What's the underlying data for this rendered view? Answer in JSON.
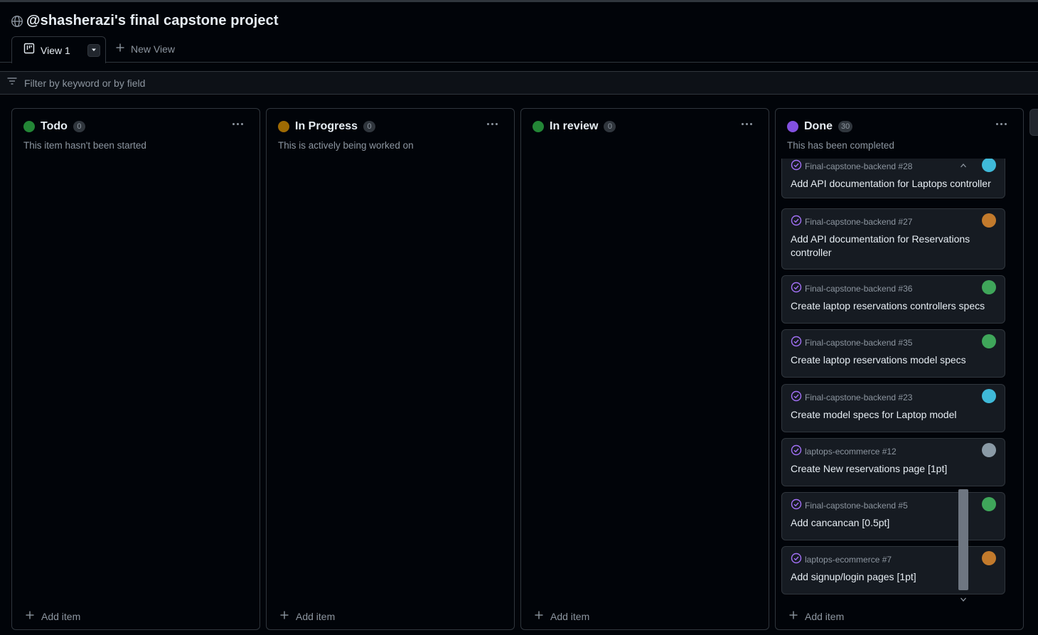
{
  "project": {
    "title": "@shasherazi's final capstone project"
  },
  "views": {
    "active_label": "View 1",
    "new_view_label": "New View"
  },
  "filter": {
    "placeholder": "Filter by keyword or by field"
  },
  "columns": [
    {
      "title": "Todo",
      "count": "0",
      "description": "This item hasn't been started",
      "color": "#238636",
      "add_label": "Add item"
    },
    {
      "title": "In Progress",
      "count": "0",
      "description": "This is actively being worked on",
      "color": "#9e6a03",
      "add_label": "Add item"
    },
    {
      "title": "In review",
      "count": "0",
      "description": "",
      "color": "#238636",
      "add_label": "Add item"
    },
    {
      "title": "Done",
      "count": "30",
      "description": "This has been completed",
      "color": "#8250df",
      "add_label": "Add item"
    }
  ],
  "done_cards": [
    {
      "ref": "Final-capstone-backend #28",
      "title": "Add API documentation for Laptops controller",
      "avatar_color": "#3fb9d8"
    },
    {
      "ref": "Final-capstone-backend #27",
      "title": "Add API documentation for Reservations controller",
      "avatar_color": "#c27a2c"
    },
    {
      "ref": "Final-capstone-backend #36",
      "title": "Create laptop reservations controllers specs",
      "avatar_color": "#3fa65a"
    },
    {
      "ref": "Final-capstone-backend #35",
      "title": "Create laptop reservations model specs",
      "avatar_color": "#3fa65a"
    },
    {
      "ref": "Final-capstone-backend #23",
      "title": "Create model specs for Laptop model",
      "avatar_color": "#3fb9d8"
    },
    {
      "ref": "laptops-ecommerce #12",
      "title": "Create New reservations page [1pt]",
      "avatar_color": "#8a9aa6"
    },
    {
      "ref": "Final-capstone-backend #5",
      "title": "Add cancancan [0.5pt]",
      "avatar_color": "#3fa65a"
    },
    {
      "ref": "laptops-ecommerce #7",
      "title": "Add signup/login pages [1pt]",
      "avatar_color": "#c27a2c"
    }
  ],
  "icons": {
    "globe": "globe-icon",
    "board": "project-board-icon",
    "caret": "triangle-down-icon",
    "plus": "plus-icon",
    "filter": "filter-icon",
    "menu": "kebab-horizontal-icon",
    "issue_closed": "issue-closed-icon"
  },
  "theme": {
    "accent_done": "#a371f7",
    "border": "#30363d",
    "muted": "#8d96a0"
  }
}
